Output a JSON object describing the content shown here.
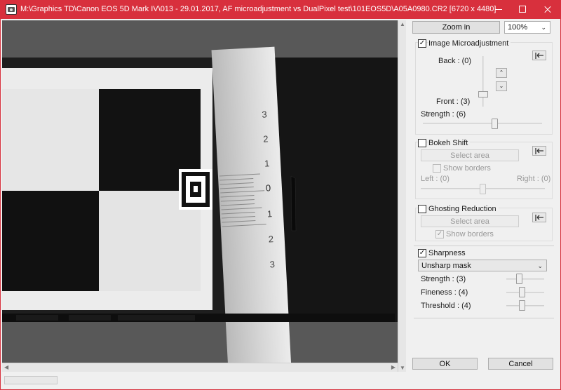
{
  "window": {
    "title": "M:\\Graphics TD\\Canon EOS 5D Mark IV\\013 - 29.01.2017, AF microadjustment vs DualPixel test\\101EOS5D\\A05A0980.CR2 [6720 x 4480]"
  },
  "toolbar": {
    "zoom_in_label": "Zoom in",
    "zoom_value": "100%"
  },
  "microadjustment": {
    "checked": true,
    "label": "Image Microadjustment",
    "back_label": "Back : (0)",
    "front_label": "Front : (3)",
    "strength_label": "Strength : (6)",
    "front_value": 3,
    "strength_value": 6
  },
  "bokeh_shift": {
    "checked": false,
    "label": "Bokeh Shift",
    "select_area_label": "Select area",
    "show_borders_label": "Show borders",
    "show_borders_checked": false,
    "left_label": "Left : (0)",
    "right_label": "Right : (0)"
  },
  "ghosting": {
    "checked": false,
    "label": "Ghosting Reduction",
    "select_area_label": "Select area",
    "show_borders_label": "Show borders",
    "show_borders_checked": true
  },
  "sharpness": {
    "checked": true,
    "label": "Sharpness",
    "mode": "Unsharp mask",
    "strength_label": "Strength : (3)",
    "fineness_label": "Fineness : (4)",
    "threshold_label": "Threshold : (4)",
    "strength_value": 3,
    "fineness_value": 4,
    "threshold_value": 4
  },
  "dialog": {
    "ok_label": "OK",
    "cancel_label": "Cancel"
  },
  "preview": {
    "ruler_numbers": [
      "3",
      "2",
      "1",
      "0",
      "1",
      "2",
      "3"
    ]
  },
  "colors": {
    "titlebar": "#d8303d",
    "preview_bg": "#585858"
  }
}
